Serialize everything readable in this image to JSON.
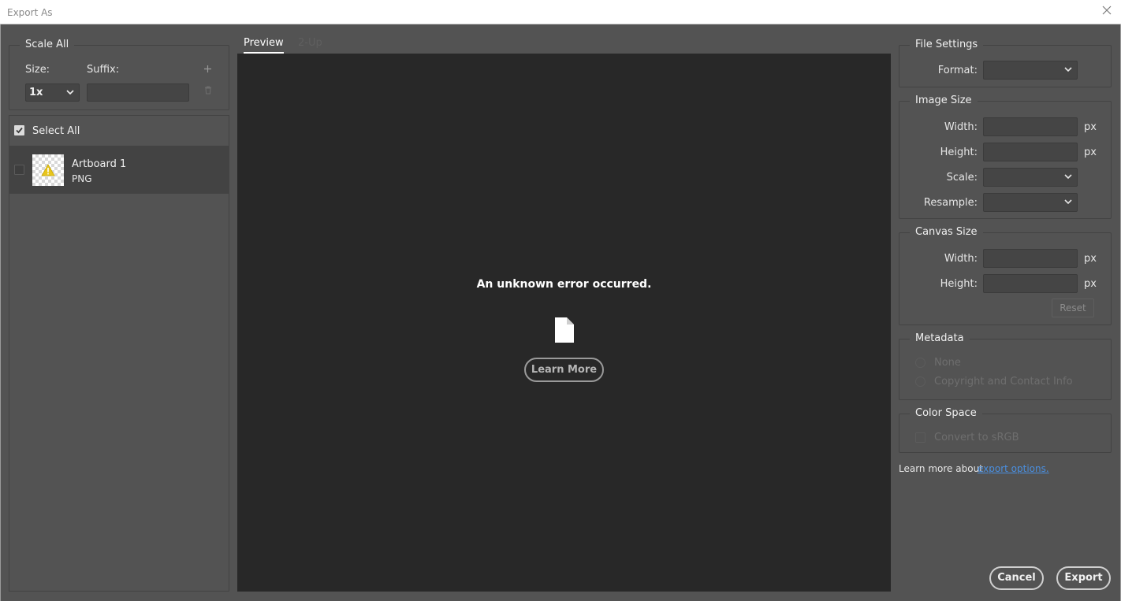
{
  "window": {
    "title": "Export As"
  },
  "scale_all": {
    "legend": "Scale All",
    "size_label": "Size:",
    "suffix_label": "Suffix:",
    "size_value": "1x",
    "suffix_value": ""
  },
  "list": {
    "select_all_label": "Select All",
    "items": [
      {
        "name": "Artboard 1",
        "format": "PNG"
      }
    ]
  },
  "preview": {
    "tabs": [
      {
        "label": "Preview"
      },
      {
        "label": "2-Up"
      }
    ],
    "error_message": "An unknown error occurred.",
    "learn_more_label": "Learn More"
  },
  "file_settings": {
    "legend": "File Settings",
    "format_label": "Format:",
    "format_value": ""
  },
  "image_size": {
    "legend": "Image Size",
    "width_label": "Width:",
    "height_label": "Height:",
    "scale_label": "Scale:",
    "resample_label": "Resample:",
    "unit": "px",
    "width_value": "",
    "height_value": ""
  },
  "canvas_size": {
    "legend": "Canvas Size",
    "width_label": "Width:",
    "height_label": "Height:",
    "unit": "px",
    "reset_label": "Reset"
  },
  "metadata": {
    "legend": "Metadata",
    "options": [
      {
        "label": "None"
      },
      {
        "label": "Copyright and Contact Info"
      }
    ]
  },
  "color_space": {
    "legend": "Color Space",
    "convert_label": "Convert to sRGB"
  },
  "footer": {
    "learn_more_text": "Learn more about",
    "export_options_link": "export options.",
    "cancel_label": "Cancel",
    "export_label": "Export"
  },
  "colors": {
    "background": "#535353",
    "preview_bg": "#282828",
    "link": "#4a8fe0",
    "warning": "#e8c51c"
  }
}
